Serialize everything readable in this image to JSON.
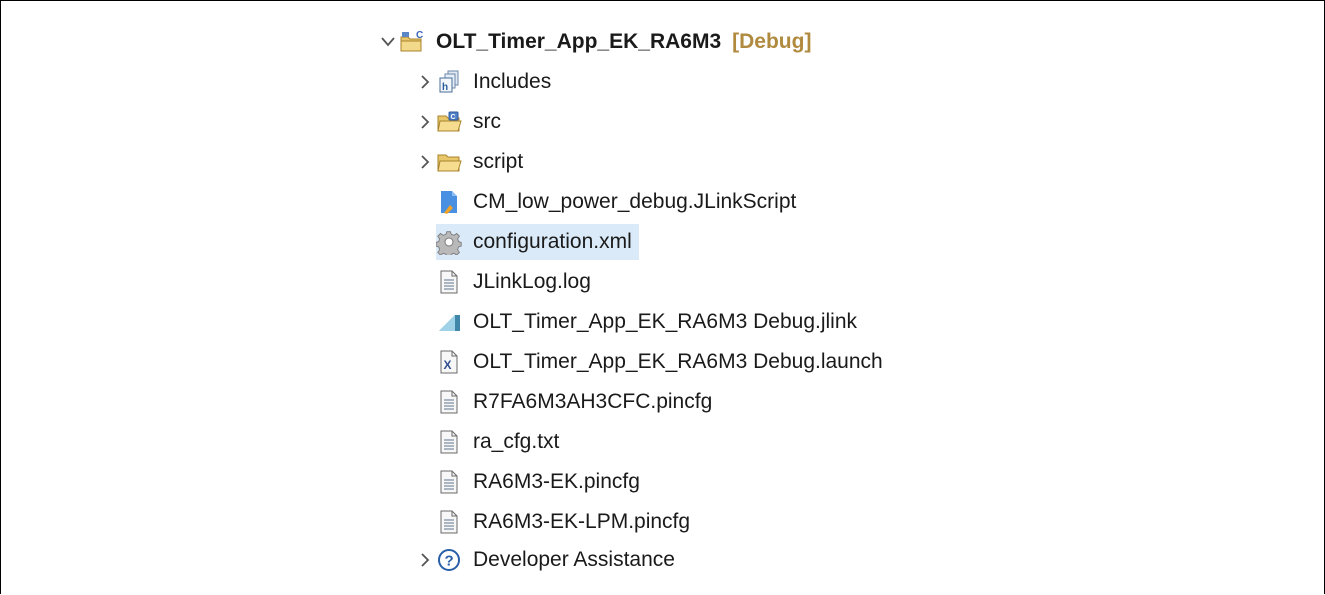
{
  "tree": {
    "root": {
      "label": "OLT_Timer_App_EK_RA6M3",
      "decoration": "[Debug]",
      "icon": "c-project-icon",
      "expanded": true
    },
    "children": [
      {
        "label": "Includes",
        "icon": "includes-icon",
        "expandable": true
      },
      {
        "label": "src",
        "icon": "source-folder-icon",
        "expandable": true
      },
      {
        "label": "script",
        "icon": "folder-icon",
        "expandable": true
      },
      {
        "label": "CM_low_power_debug.JLinkScript",
        "icon": "script-file-icon",
        "expandable": false
      },
      {
        "label": "configuration.xml",
        "icon": "gear-icon",
        "expandable": false,
        "selected": true
      },
      {
        "label": "JLinkLog.log",
        "icon": "text-file-icon",
        "expandable": false
      },
      {
        "label": "OLT_Timer_App_EK_RA6M3 Debug.jlink",
        "icon": "jlink-file-icon",
        "expandable": false
      },
      {
        "label": "OLT_Timer_App_EK_RA6M3 Debug.launch",
        "icon": "launch-file-icon",
        "expandable": false
      },
      {
        "label": "R7FA6M3AH3CFC.pincfg",
        "icon": "text-file-icon",
        "expandable": false
      },
      {
        "label": "ra_cfg.txt",
        "icon": "text-file-icon",
        "expandable": false
      },
      {
        "label": "RA6M3-EK.pincfg",
        "icon": "text-file-icon",
        "expandable": false
      },
      {
        "label": "RA6M3-EK-LPM.pincfg",
        "icon": "text-file-icon",
        "expandable": false
      },
      {
        "label": "Developer Assistance",
        "icon": "help-icon",
        "expandable": true
      }
    ]
  },
  "colors": {
    "selection": "#dbeaf8",
    "decoration": "#b08a3e",
    "text": "#1a1a1a"
  }
}
